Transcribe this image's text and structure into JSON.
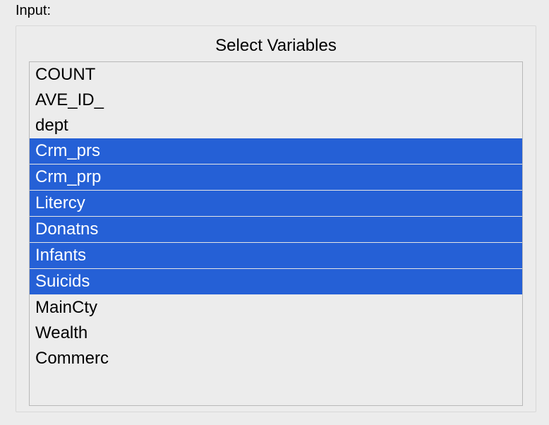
{
  "section_label": "Input:",
  "panel": {
    "title": "Select Variables",
    "items": [
      {
        "label": "COUNT",
        "selected": false
      },
      {
        "label": "AVE_ID_",
        "selected": false
      },
      {
        "label": "dept",
        "selected": false
      },
      {
        "label": "Crm_prs",
        "selected": true
      },
      {
        "label": "Crm_prp",
        "selected": true
      },
      {
        "label": "Litercy",
        "selected": true
      },
      {
        "label": "Donatns",
        "selected": true
      },
      {
        "label": "Infants",
        "selected": true
      },
      {
        "label": "Suicids",
        "selected": true
      },
      {
        "label": "MainCty",
        "selected": false
      },
      {
        "label": "Wealth",
        "selected": false
      },
      {
        "label": "Commerc",
        "selected": false
      }
    ]
  }
}
